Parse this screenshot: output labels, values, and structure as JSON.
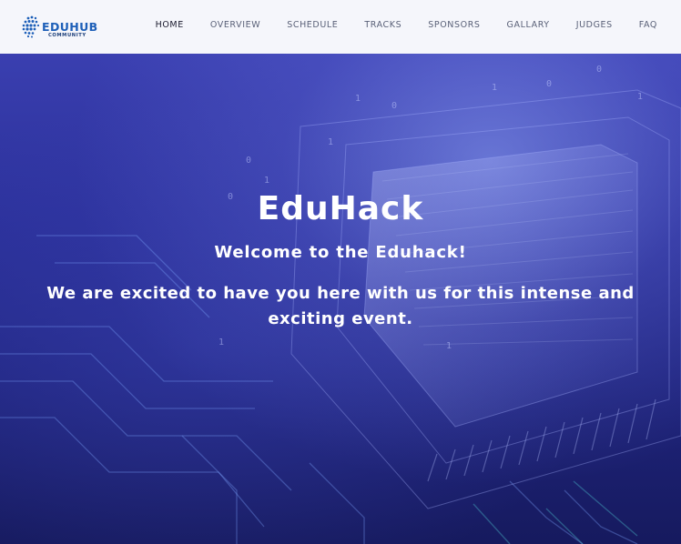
{
  "brand": {
    "name": "EDUHUB",
    "tagline": "COMMUNITY",
    "color": "#1d5fb8"
  },
  "nav": {
    "items": [
      {
        "label": "HOME",
        "active": true
      },
      {
        "label": "OVERVIEW",
        "active": false
      },
      {
        "label": "SCHEDULE",
        "active": false
      },
      {
        "label": "TRACKS",
        "active": false
      },
      {
        "label": "SPONSORS",
        "active": false
      },
      {
        "label": "GALLARY",
        "active": false
      },
      {
        "label": "JUDGES",
        "active": false
      },
      {
        "label": "FAQ",
        "active": false
      }
    ]
  },
  "hero": {
    "title": "EduHack",
    "welcome": "Welcome to the Eduhack!",
    "description": "We are excited to have you here with us for this intense and exciting event.",
    "background": "circuit-board-image",
    "colors": {
      "overlay": "#2a2f98",
      "text": "#ffffff"
    }
  }
}
